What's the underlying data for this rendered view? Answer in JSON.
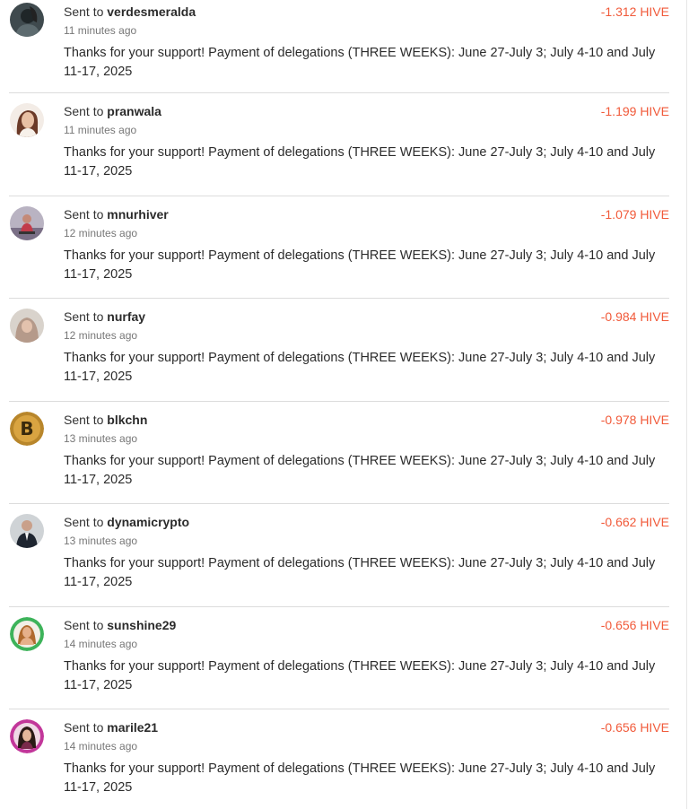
{
  "transactions": [
    {
      "prefix": "Sent to",
      "user": "verdesmeralda",
      "time": "11 minutes ago",
      "amount": "-1.312 HIVE",
      "memo": "Thanks for your support! Payment of delegations (THREE WEEKS): June 27-July 3; July 4-10 and July 11-17, 2025",
      "avatar_icon": "user-avatar-icon"
    },
    {
      "prefix": "Sent to",
      "user": "pranwala",
      "time": "11 minutes ago",
      "amount": "-1.199 HIVE",
      "memo": "Thanks for your support! Payment of delegations (THREE WEEKS): June 27-July 3; July 4-10 and July 11-17, 2025",
      "avatar_icon": "user-avatar-icon"
    },
    {
      "prefix": "Sent to",
      "user": "mnurhiver",
      "time": "12 minutes ago",
      "amount": "-1.079 HIVE",
      "memo": "Thanks for your support! Payment of delegations (THREE WEEKS): June 27-July 3; July 4-10 and July 11-17, 2025",
      "avatar_icon": "user-avatar-icon"
    },
    {
      "prefix": "Sent to",
      "user": "nurfay",
      "time": "12 minutes ago",
      "amount": "-0.984 HIVE",
      "memo": "Thanks for your support! Payment of delegations (THREE WEEKS): June 27-July 3; July 4-10 and July 11-17, 2025",
      "avatar_icon": "user-avatar-icon"
    },
    {
      "prefix": "Sent to",
      "user": "blkchn",
      "time": "13 minutes ago",
      "amount": "-0.978 HIVE",
      "memo": "Thanks for your support! Payment of delegations (THREE WEEKS): June 27-July 3; July 4-10 and July 11-17, 2025",
      "avatar_icon": "bitcoin-avatar-icon"
    },
    {
      "prefix": "Sent to",
      "user": "dynamicrypto",
      "time": "13 minutes ago",
      "amount": "-0.662 HIVE",
      "memo": "Thanks for your support! Payment of delegations (THREE WEEKS): June 27-July 3; July 4-10 and July 11-17, 2025",
      "avatar_icon": "user-avatar-icon"
    },
    {
      "prefix": "Sent to",
      "user": "sunshine29",
      "time": "14 minutes ago",
      "amount": "-0.656 HIVE",
      "memo": "Thanks for your support! Payment of delegations (THREE WEEKS): June 27-July 3; July 4-10 and July 11-17, 2025",
      "avatar_icon": "user-avatar-icon"
    },
    {
      "prefix": "Sent to",
      "user": "marile21",
      "time": "14 minutes ago",
      "amount": "-0.656 HIVE",
      "memo": "Thanks for your support! Payment of delegations (THREE WEEKS): June 27-July 3; July 4-10 and July 11-17, 2025",
      "avatar_icon": "user-avatar-icon"
    }
  ],
  "colors": {
    "amount_negative": "#f15a3a",
    "divider": "#dcdcdc",
    "text": "#2b2b2b",
    "muted": "#777777"
  }
}
